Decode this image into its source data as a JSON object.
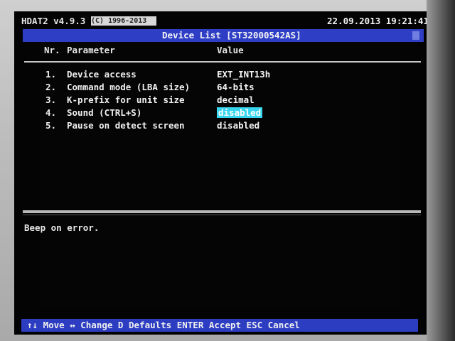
{
  "header": {
    "version": "HDAT2 v4.9.3",
    "version_tail": "(C) 1996-2013",
    "datetime": "22.09.2013 19:21:41"
  },
  "title": "Device List [ST32000542AS]",
  "columns": {
    "nr": "Nr.",
    "parameter": "Parameter",
    "value": "Value"
  },
  "rows": [
    {
      "num": "1.",
      "param": "Device access",
      "value": "EXT_INT13h"
    },
    {
      "num": "2.",
      "param": "Command mode (LBA size)",
      "value": "64-bits"
    },
    {
      "num": "3.",
      "param": "K-prefix for unit size",
      "value": "decimal"
    },
    {
      "num": "4.",
      "param": "Sound (CTRL+S)",
      "value": "disabled",
      "selected": true
    },
    {
      "num": "5.",
      "param": "Pause on detect screen",
      "value": "disabled"
    }
  ],
  "help": "Beep on error.",
  "keys": "↑↓ Move ↔ Change D Defaults ENTER Accept ESC Cancel",
  "colors": {
    "title_bar": "#2e3fc6",
    "selection": "#38d6ee",
    "bezel": "#c4c4c4"
  }
}
